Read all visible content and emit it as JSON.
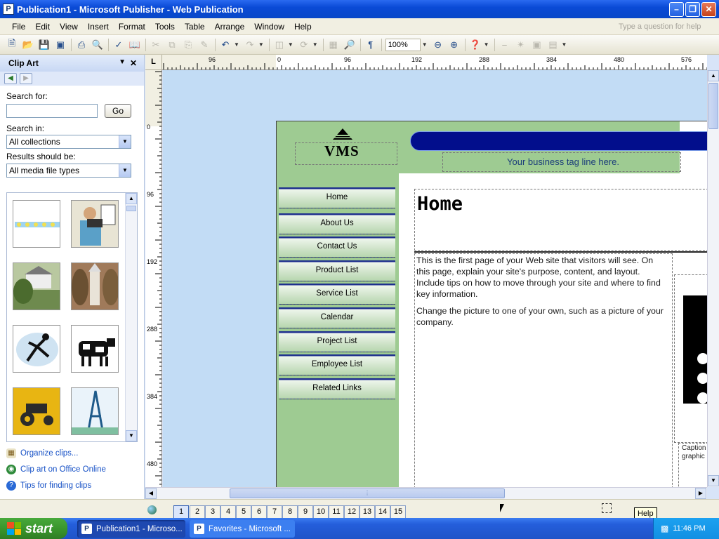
{
  "window": {
    "title": "Publication1 - Microsoft Publisher - Web Publication",
    "app_icon": "P"
  },
  "menu": {
    "items": [
      "File",
      "Edit",
      "View",
      "Insert",
      "Format",
      "Tools",
      "Table",
      "Arrange",
      "Window",
      "Help"
    ],
    "ask_placeholder": "Type a question for help"
  },
  "toolbar": {
    "zoom": "100%",
    "pilcrow": "¶"
  },
  "taskpane": {
    "title": "Clip Art",
    "search_for_label": "Search for:",
    "search_value": "",
    "go_label": "Go",
    "search_in_label": "Search in:",
    "search_in_value": "All collections",
    "results_label": "Results should be:",
    "results_value": "All media file types",
    "links": [
      {
        "label": "Organize clips...",
        "icon": "organize-icon"
      },
      {
        "label": "Clip art on Office Online",
        "icon": "globe-icon"
      },
      {
        "label": "Tips for finding clips",
        "icon": "help-icon"
      }
    ]
  },
  "rulers": {
    "corner": "L",
    "h_labels": [
      "96",
      "0",
      "96",
      "192",
      "288",
      "384",
      "480",
      "576"
    ],
    "v_labels": [
      "0",
      "96",
      "192",
      "288",
      "384",
      "480"
    ]
  },
  "publication": {
    "logo_text": "VMS",
    "tagline": "Your business tag line here.",
    "nav": [
      "Home",
      "About Us",
      "Contact Us",
      "Product List",
      "Service List",
      "Calendar",
      "Project List",
      "Employee List",
      "Related Links"
    ],
    "heading": "Home",
    "paragraph1": "This is the first page of your Web site that visitors will see. On this page, explain your site's purpose, content, and layout. Include tips on how to move through your site and where to find key information.",
    "paragraph2": "Change the picture to one of your own, such as a picture of your company.",
    "caption_line1": "Caption",
    "caption_line2": "graphic"
  },
  "pages": [
    "1",
    "2",
    "3",
    "4",
    "5",
    "6",
    "7",
    "8",
    "9",
    "10",
    "11",
    "12",
    "13",
    "14",
    "15"
  ],
  "taskbar": {
    "start_label": "start",
    "buttons": [
      {
        "label": "Publication1 - Microso...",
        "icon": "publisher-icon"
      },
      {
        "label": "Favorites - Microsoft ...",
        "icon": "publisher-icon"
      }
    ],
    "clock": "11:46 PM"
  },
  "tooltip": "Help"
}
